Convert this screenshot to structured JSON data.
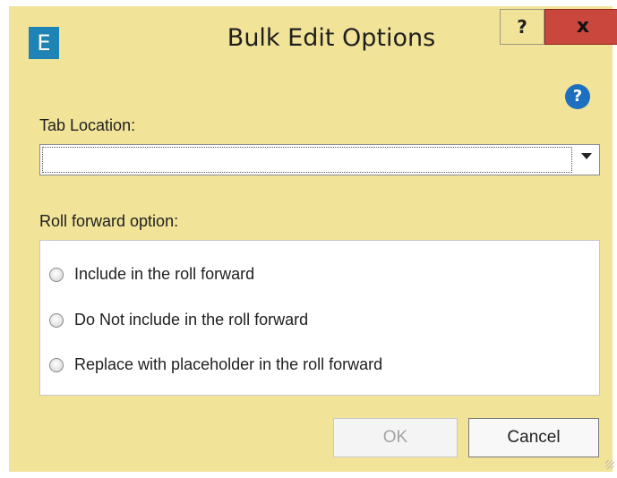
{
  "window": {
    "app_icon_text": "E",
    "title": "Bulk Edit Options",
    "help_label": "?",
    "close_label": "x"
  },
  "form": {
    "tab_location_label": "Tab Location:",
    "tab_location_value": "",
    "roll_forward_label": "Roll forward option:",
    "options": [
      {
        "label": "Include in the roll forward",
        "selected": false
      },
      {
        "label": "Do Not include in the roll forward",
        "selected": false
      },
      {
        "label": "Replace with placeholder in the roll forward",
        "selected": false
      }
    ],
    "help_icon_text": "?"
  },
  "buttons": {
    "ok_label": "OK",
    "cancel_label": "Cancel"
  },
  "colors": {
    "dialog_bg": "#f1e398",
    "close_bg": "#c9473d",
    "app_icon_bg": "#1e84b6",
    "help_icon_bg": "#1d6fbf"
  }
}
